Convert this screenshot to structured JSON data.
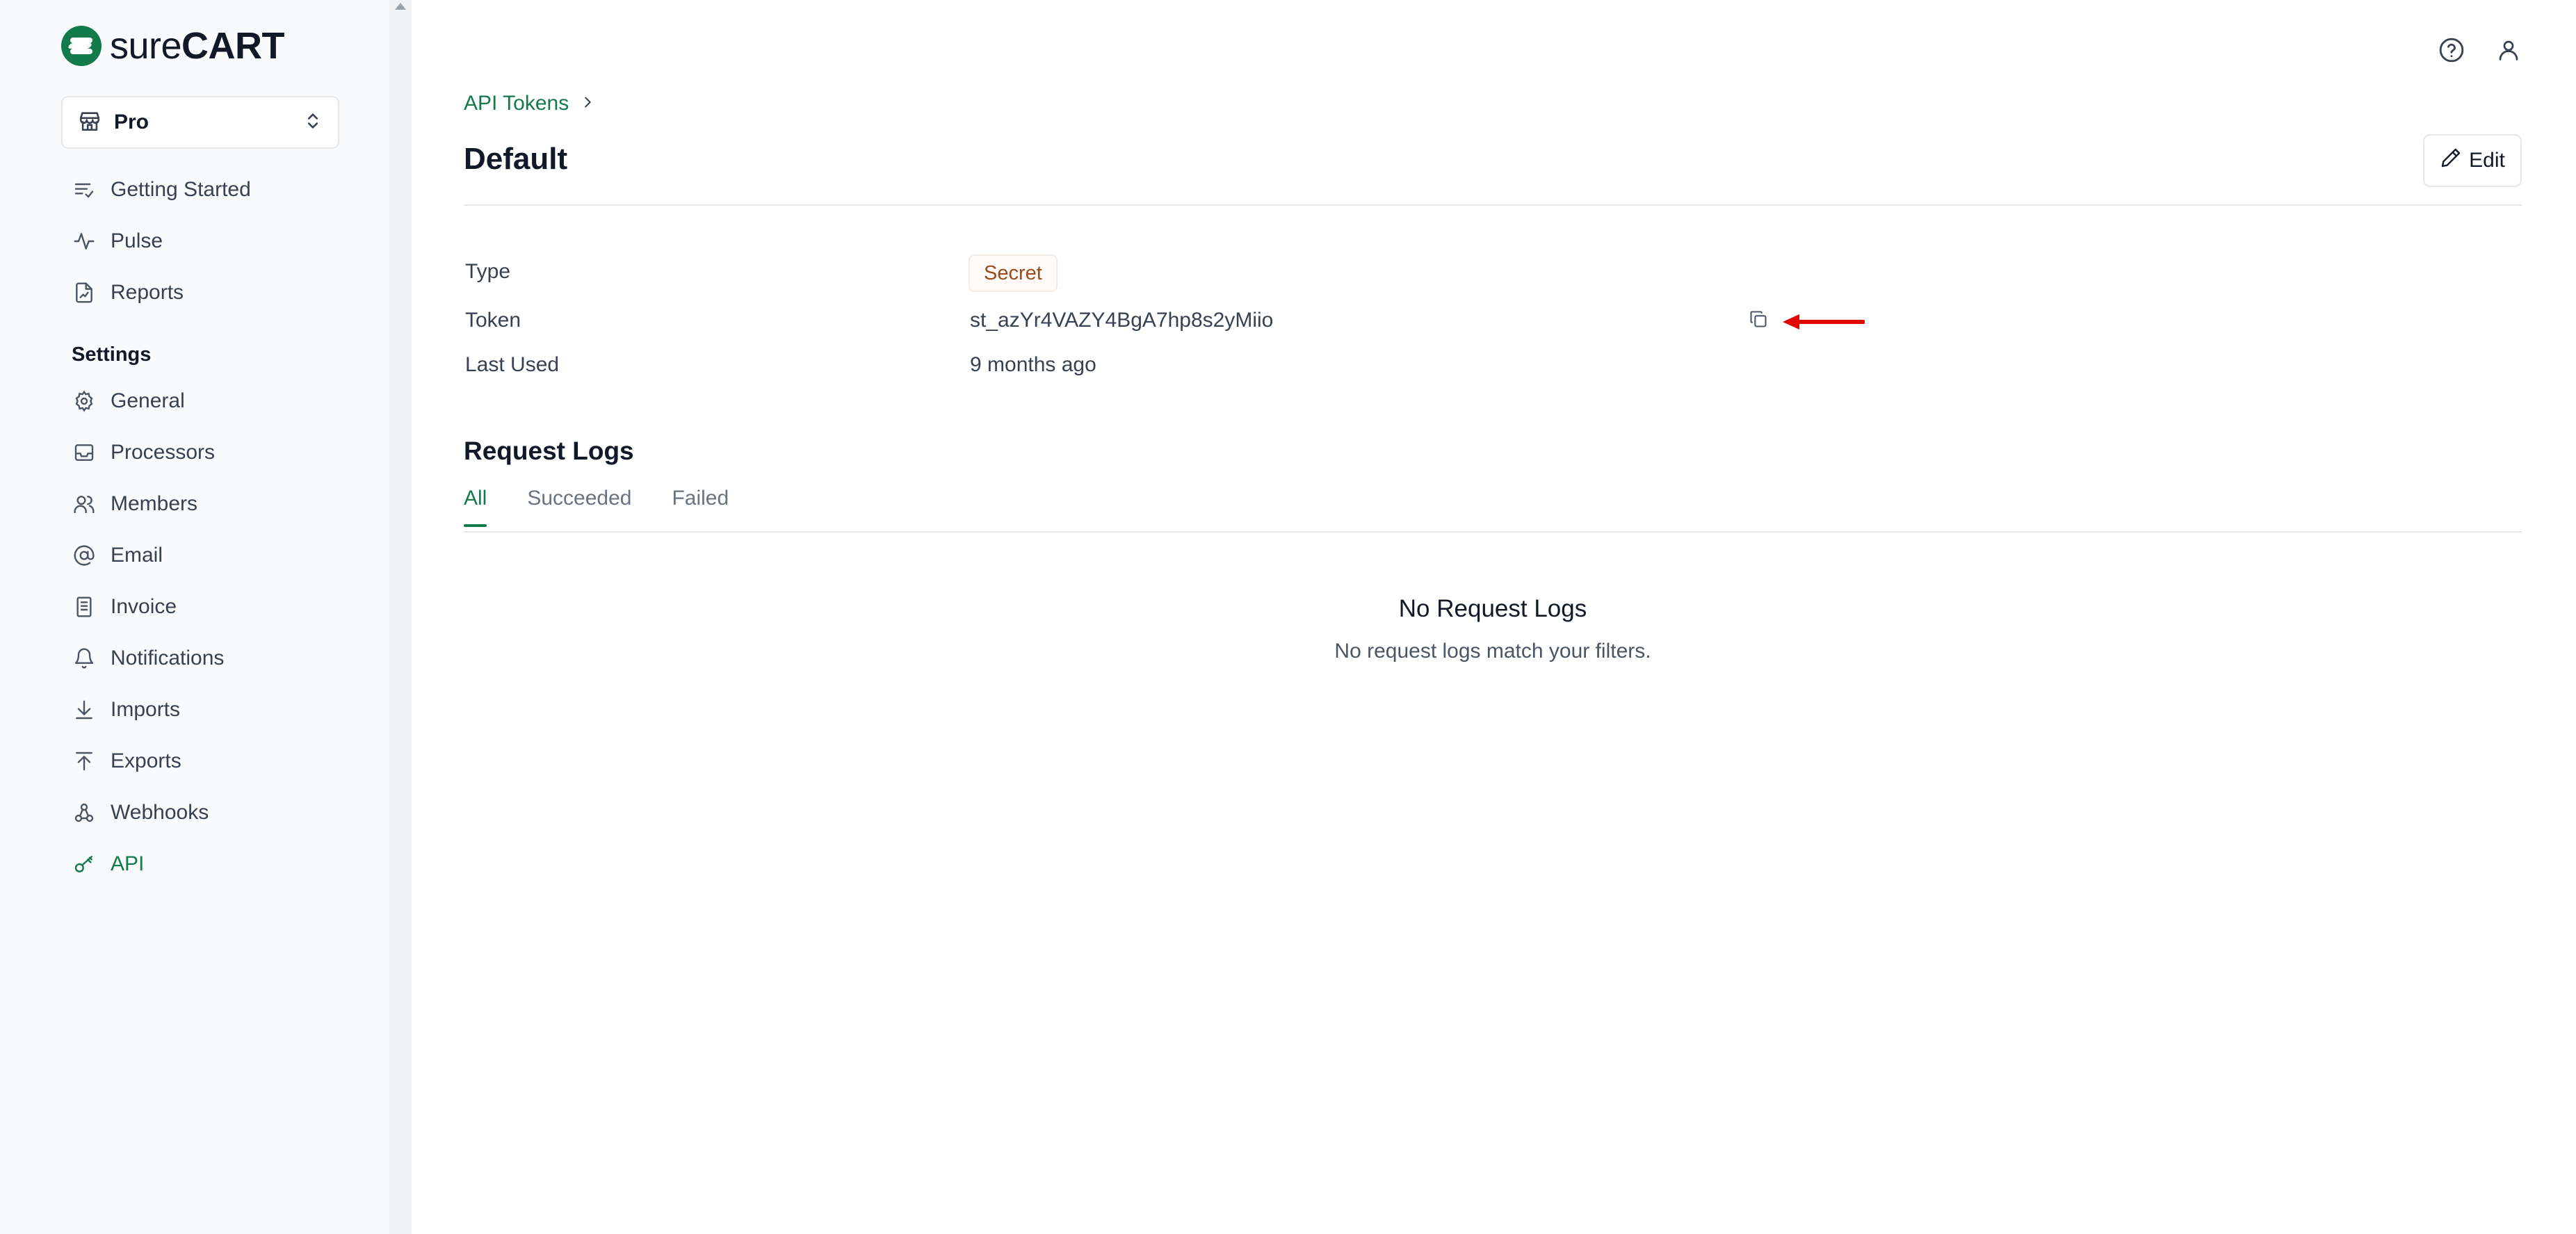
{
  "brand": {
    "text_light": "sure",
    "text_bold": "CART",
    "accent": "#137a4c"
  },
  "store_select": {
    "label": "Pro"
  },
  "sidebar": {
    "items_top": [
      {
        "label": "Getting Started",
        "icon": "list-check-icon"
      },
      {
        "label": "Pulse",
        "icon": "activity-icon"
      },
      {
        "label": "Reports",
        "icon": "chart-file-icon"
      }
    ],
    "settings_heading": "Settings",
    "items_settings": [
      {
        "label": "General",
        "icon": "gear-icon"
      },
      {
        "label": "Processors",
        "icon": "inbox-icon"
      },
      {
        "label": "Members",
        "icon": "users-icon"
      },
      {
        "label": "Email",
        "icon": "at-icon"
      },
      {
        "label": "Invoice",
        "icon": "document-icon"
      },
      {
        "label": "Notifications",
        "icon": "bell-icon"
      },
      {
        "label": "Imports",
        "icon": "download-icon"
      },
      {
        "label": "Exports",
        "icon": "upload-icon"
      },
      {
        "label": "Webhooks",
        "icon": "webhook-icon"
      },
      {
        "label": "API",
        "icon": "key-icon",
        "active": true
      }
    ]
  },
  "header": {
    "icons": [
      "help-icon",
      "user-icon"
    ]
  },
  "breadcrumb": {
    "parent": "API Tokens"
  },
  "page": {
    "title": "Default",
    "edit_label": "Edit"
  },
  "details": {
    "type_label": "Type",
    "type_value": "Secret",
    "token_label": "Token",
    "token_value": "st_azYr4VAZY4BgA7hp8s2yMiio",
    "last_used_label": "Last Used",
    "last_used_value": "9 months ago"
  },
  "request_logs": {
    "title": "Request Logs",
    "tabs": [
      "All",
      "Succeeded",
      "Failed"
    ],
    "active_tab": "All",
    "empty_title": "No Request Logs",
    "empty_subtitle": "No request logs match your filters."
  },
  "colors": {
    "badge_text": "#9a4a1c",
    "annotation_arrow": "#e10600"
  }
}
